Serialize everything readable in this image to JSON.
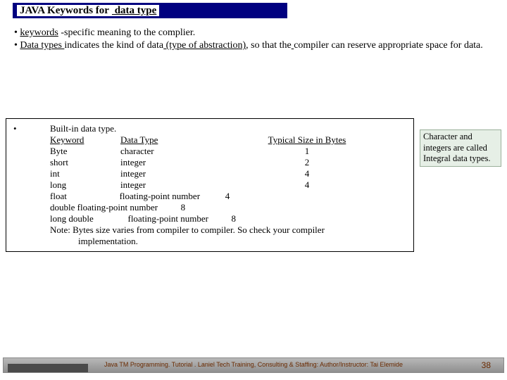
{
  "title": {
    "plain1": "JAVA Keywords for",
    "underlined": " data type"
  },
  "bullets": {
    "line1_a": "keywords",
    "line1_b": " -specific meaning to the complier.",
    "line2_a": "Data types ",
    "line2_b": "indicates the kind of data",
    "line2_c": " (type of abstraction)",
    "line2_d": ", so that the",
    "line2_e": " compiler can reserve appropriate space for data."
  },
  "table": {
    "heading": "Built-in data type.",
    "hdr1": "Keyword",
    "hdr2": "Data Type",
    "hdr3": "Typical Size in Bytes",
    "rows": [
      {
        "k": "Byte",
        "t": "character",
        "s": "1"
      },
      {
        "k": "short",
        "t": "integer",
        "s": "2"
      },
      {
        "k": "int",
        "t": "integer",
        "s": "4"
      },
      {
        "k": "long",
        "t": "integer",
        "s": "4"
      }
    ],
    "float_line": "float                       floating-point number           4",
    "double_line": "double floating-point number          8",
    "longdouble_line": "long double               floating-point number          8",
    "note1": "Note: Bytes size varies from compiler to compiler. So check your compiler",
    "note2": "implementation."
  },
  "callout": "Character and integers are called Integral data types.",
  "footer": {
    "text": "Java TM Programming. Tutorial .  Laniel Tech Training, Consulting & Staffing: Author/Instructor: Tai Elemide",
    "page": "38"
  }
}
